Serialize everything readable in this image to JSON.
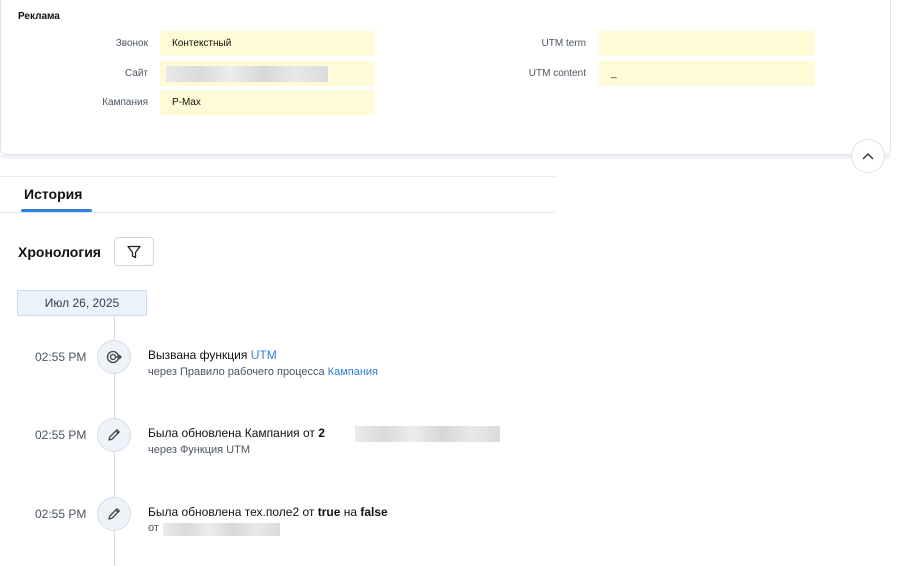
{
  "ads": {
    "title": "Реклама",
    "fields": {
      "call_label": "Звонок",
      "call_value": "Контекстный",
      "site_label": "Сайт",
      "site_value": "",
      "campaign_label": "Кампания",
      "campaign_value": "P-Max",
      "utm_term_label": "UTM term",
      "utm_term_value": "",
      "utm_content_label": "UTM content",
      "utm_content_value": "_"
    }
  },
  "history": {
    "tab_label": "История",
    "chronology_title": "Хронология",
    "date": "Июл 26, 2025",
    "entries": [
      {
        "time": "02:55 PM",
        "title_prefix": "Вызвана функция ",
        "title_link": "UTM",
        "sub_prefix": "через Правило рабочего процесса ",
        "sub_link": "Кампания"
      },
      {
        "time": "02:55 PM",
        "title_prefix": "Была обновлена Кампания от ",
        "title_bold": "2",
        "sub": "через Функция UTM"
      },
      {
        "time": "02:55 PM",
        "title_prefix": "Была обновлена тех.поле2 от ",
        "title_bold1": "true",
        "title_mid": " на ",
        "title_bold2": "false",
        "sub_prefix": "от "
      }
    ]
  },
  "colors": {
    "accent": "#2f7ed8",
    "field_bg": "#fffbd6",
    "date_chip_bg": "#eaf2fb"
  },
  "icons": {
    "collapse": "chevron-up-icon",
    "filter": "filter-icon",
    "function": "function-call-icon",
    "edit": "pencil-icon"
  }
}
